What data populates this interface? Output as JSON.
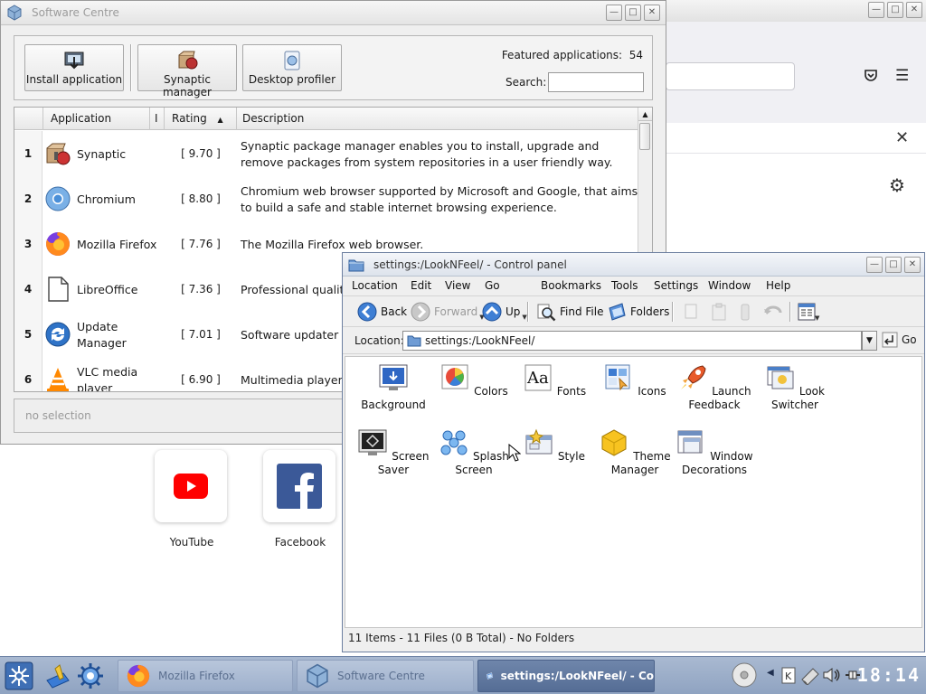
{
  "firefox": {
    "tiles": [
      {
        "label": "YouTube"
      },
      {
        "label": "Facebook"
      }
    ]
  },
  "software_centre": {
    "title": "Software Centre",
    "buttons": {
      "install": "Install application",
      "synaptic": "Synaptic manager",
      "profiler": "Desktop profiler"
    },
    "featured_label": "Featured applications:",
    "featured_count": "54",
    "search_label": "Search:",
    "search_value": "",
    "columns": {
      "application": "Application",
      "i": "I",
      "rating": "Rating",
      "description": "Description"
    },
    "rows": [
      {
        "num": "1",
        "name": "Synaptic",
        "rating": "[ 9.70 ]",
        "desc": "Synaptic package manager enables you to install, upgrade and remove packages from system repositories in a user friendly way."
      },
      {
        "num": "2",
        "name": "Chromium",
        "rating": "[ 8.80 ]",
        "desc": "Chromium web browser supported by Microsoft and Google, that aims to build a safe and stable internet browsing experience."
      },
      {
        "num": "3",
        "name": "Mozilla Firefox",
        "rating": "[ 7.76 ]",
        "desc": "The Mozilla Firefox web browser."
      },
      {
        "num": "4",
        "name": "LibreOffice",
        "rating": "[ 7.36 ]",
        "desc": "Professional quality"
      },
      {
        "num": "5",
        "name": "Update Manager",
        "rating": "[ 7.01 ]",
        "desc": "Software updater a software updates a"
      },
      {
        "num": "6",
        "name": "VLC media player",
        "rating": "[ 6.90 ]",
        "desc": "Multimedia player a"
      }
    ],
    "status": "no selection"
  },
  "control_panel": {
    "title": "settings:/LookNFeel/ - Control panel",
    "menu": [
      "Location",
      "Edit",
      "View",
      "Go",
      "Bookmarks",
      "Tools",
      "Settings",
      "Window",
      "Help"
    ],
    "toolbar": {
      "back": "Back",
      "forward": "Forward",
      "up": "Up",
      "find": "Find File",
      "folders": "Folders"
    },
    "location_label": "Location:",
    "location_value": "settings:/LookNFeel/",
    "go_label": "Go",
    "items": [
      {
        "label": "Background"
      },
      {
        "label": "Colors"
      },
      {
        "label": "Fonts"
      },
      {
        "label": "Icons"
      },
      {
        "label": "Launch Feedback"
      },
      {
        "label": "Look Switcher"
      },
      {
        "label": "Screen Saver"
      },
      {
        "label": "Splash Screen"
      },
      {
        "label": "Style"
      },
      {
        "label": "Theme Manager"
      },
      {
        "label": "Window Decorations"
      }
    ],
    "status": "11 Items - 11 Files (0 B Total) - No Folders"
  },
  "taskbar": {
    "tasks": [
      {
        "label": "Mozilla Firefox"
      },
      {
        "label": "Software Centre"
      },
      {
        "label": "settings:/LookNFeel/ - Co"
      }
    ],
    "clock": "18:14"
  },
  "colors": {
    "taskbar": "#8fa3c1",
    "active_task": "#556d95",
    "titlebar_active": "#dde3ec"
  }
}
